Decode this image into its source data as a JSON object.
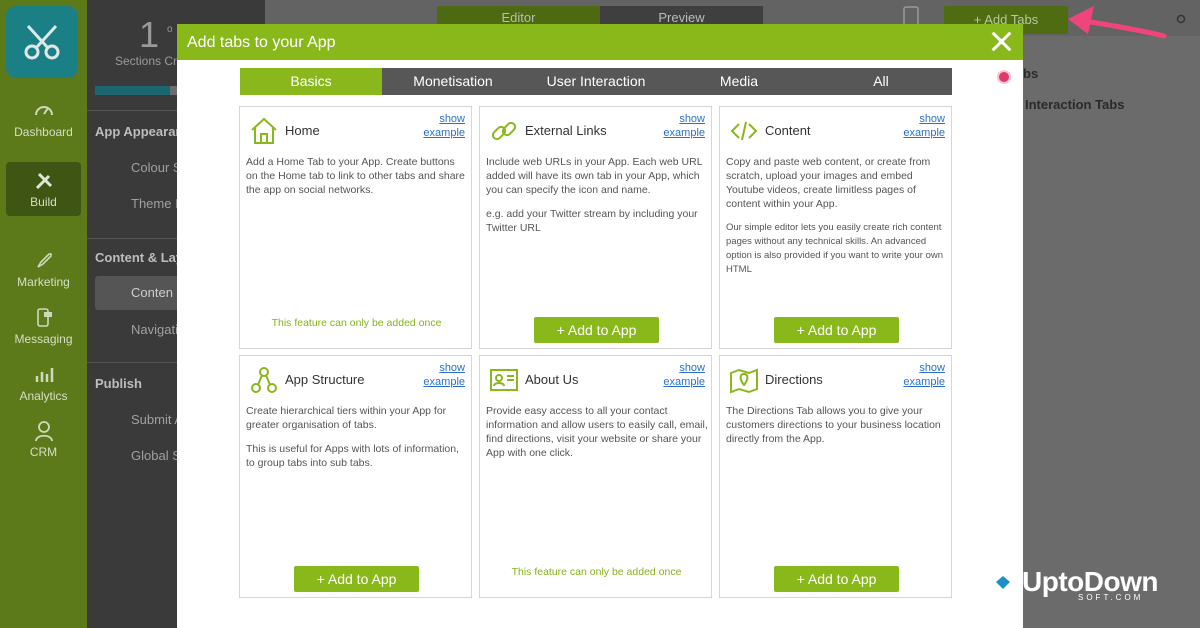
{
  "colors": {
    "accent": "#89b81b",
    "tab_bar": "#575757",
    "link": "#2a72c7",
    "note": "#86b31a",
    "arrow": "#f0457a"
  },
  "sidebar": {
    "items": [
      {
        "label": "Dashboard",
        "icon": "speedometer-icon"
      },
      {
        "label": "Build",
        "icon": "tools-icon"
      },
      {
        "label": "Marketing",
        "icon": "rocket-icon"
      },
      {
        "label": "Messaging",
        "icon": "phone-message-icon"
      },
      {
        "label": "Analytics",
        "icon": "bar-chart-icon"
      },
      {
        "label": "CRM",
        "icon": "user-icon"
      }
    ]
  },
  "panel": {
    "sections_count": "1",
    "sections_label": "Sections Cr",
    "section_small": "o",
    "app_appearance": "App Appearan",
    "colour": "Colour S",
    "theme": "Theme I",
    "content_layout": "Content & Lay",
    "content": "Conten",
    "navigation": "Navigati",
    "publish": "Publish",
    "submit": "Submit A",
    "global": "Global S"
  },
  "topbar": {
    "editor": "Editor",
    "preview": "Preview",
    "add_tabs": "+ Add Tabs"
  },
  "right_panel": {
    "line1": "bs",
    "line2": "Interaction Tabs"
  },
  "modal": {
    "title": "Add tabs to your App",
    "tabs": [
      "Basics",
      "Monetisation",
      "User Interaction",
      "Media",
      "All"
    ],
    "show_example": {
      "line1": "show",
      "line2": "example"
    },
    "add_label": "+ Add to App",
    "once_note": "This feature can only be added once",
    "cards": [
      {
        "title": "Home",
        "icon": "home-icon",
        "desc": [
          "Add a Home Tab to your App. Create buttons on the Home tab to link to other tabs and share the app on social networks."
        ]
      },
      {
        "title": "External Links",
        "icon": "link-icon",
        "desc": [
          "Include web URLs in your App. Each web URL added will have its own tab in your App, which you can specify the icon and name.",
          "e.g. add your Twitter stream by including your Twitter URL"
        ]
      },
      {
        "title": "Content",
        "icon": "code-icon",
        "desc": [
          "Copy and paste web content, or create from scratch, upload your images and embed Youtube videos, create limitless pages of content within your App.",
          "Our simple editor lets you easily create rich content pages without any technical skills. An advanced option is also provided if you want to write your own HTML"
        ]
      },
      {
        "title": "App Structure",
        "icon": "hierarchy-icon",
        "desc": [
          "Create hierarchical tiers within your App for greater organisation of tabs.",
          "This is useful for Apps with lots of information, to group tabs into sub tabs."
        ]
      },
      {
        "title": "About Us",
        "icon": "contact-card-icon",
        "desc": [
          "Provide easy access to all your contact information and allow users to easily call, email, find directions, visit your website or share your App with one click."
        ]
      },
      {
        "title": "Directions",
        "icon": "map-icon",
        "desc": [
          "The Directions Tab allows you to give your customers directions to your business location directly from the App."
        ]
      }
    ]
  },
  "watermark": {
    "text": "UptoDown",
    "sub": "SOFT.COM"
  }
}
